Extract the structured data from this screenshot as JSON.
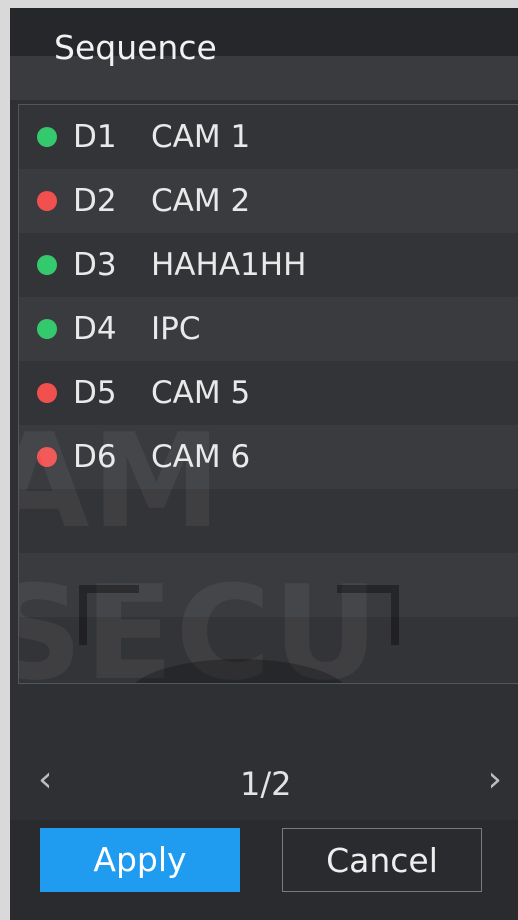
{
  "dialog": {
    "title": "Sequence"
  },
  "channels": [
    {
      "id": "D1",
      "name": "CAM 1",
      "status": "online"
    },
    {
      "id": "D2",
      "name": "CAM 2",
      "status": "offline"
    },
    {
      "id": "D3",
      "name": "HAHA1HH",
      "status": "online"
    },
    {
      "id": "D4",
      "name": "IPC",
      "status": "online"
    },
    {
      "id": "D5",
      "name": "CAM 5",
      "status": "offline"
    },
    {
      "id": "D6",
      "name": "CAM 6",
      "status": "offline"
    }
  ],
  "pagination": {
    "current": "1/2",
    "prev_icon": "chevron-left-icon",
    "next_icon": "chevron-right-icon"
  },
  "buttons": {
    "apply": "Apply",
    "cancel": "Cancel"
  },
  "colors": {
    "online": "#35c96e",
    "offline": "#f2504f",
    "accent": "#1f9bf0"
  }
}
